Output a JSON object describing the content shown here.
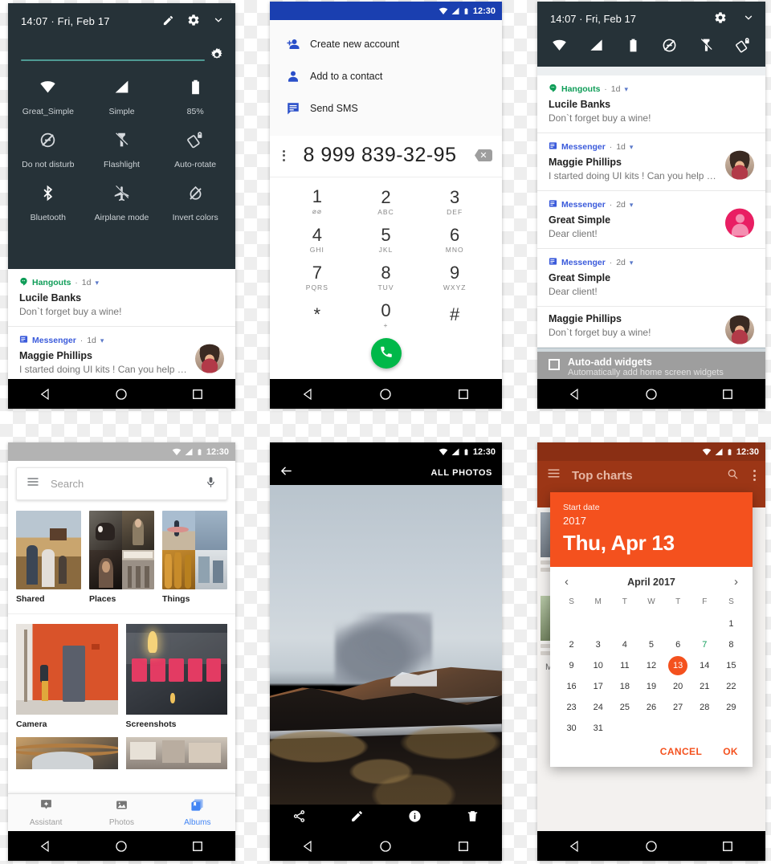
{
  "quick_settings": {
    "time": "14:07  ·  Fri, Feb 17",
    "icons": {
      "edit": "pencil-icon",
      "settings": "gear-icon",
      "collapse": "chevron-down-icon"
    },
    "brightness": {
      "value": 98,
      "knob": "brightness-icon"
    },
    "tiles": [
      {
        "label": "Great_Simple",
        "icon": "wifi-icon"
      },
      {
        "label": "Simple",
        "icon": "signal-icon"
      },
      {
        "label": "85%",
        "icon": "battery-icon"
      },
      {
        "label": "Do not disturb",
        "icon": "do-not-disturb-icon"
      },
      {
        "label": "Flashlight",
        "icon": "flashlight-off-icon"
      },
      {
        "label": "Auto-rotate",
        "icon": "auto-rotate-lock-icon"
      },
      {
        "label": "Bluetooth",
        "icon": "bluetooth-icon"
      },
      {
        "label": "Airplane mode",
        "icon": "airplane-off-icon"
      },
      {
        "label": "Invert colors",
        "icon": "invert-colors-off-icon"
      }
    ],
    "notifications": [
      {
        "app": "Hangouts",
        "app_class": "hangouts",
        "time": "1d",
        "title": "Lucile Banks",
        "body": "Don`t forget buy a wine!",
        "avatar": "none"
      },
      {
        "app": "Messenger",
        "app_class": "messenger",
        "time": "1d",
        "title": "Maggie Phillips",
        "body": "I started doing UI kits ! Can you help …",
        "avatar": "person"
      }
    ]
  },
  "dialer": {
    "status_time": "12:30",
    "menu": [
      {
        "label": "Create new account",
        "icon": "person-add-icon"
      },
      {
        "label": "Add to a contact",
        "icon": "person-icon"
      },
      {
        "label": "Send SMS",
        "icon": "message-icon"
      }
    ],
    "number": "8 999 839-32-95",
    "overflow_icon": "more-vert-icon",
    "backspace_icon": "backspace-icon",
    "call_icon": "phone-icon",
    "keys": [
      {
        "num": "1",
        "sub": "⌀⌀"
      },
      {
        "num": "2",
        "sub": "ABC"
      },
      {
        "num": "3",
        "sub": "DEF"
      },
      {
        "num": "4",
        "sub": "GHI"
      },
      {
        "num": "5",
        "sub": "JKL"
      },
      {
        "num": "6",
        "sub": "MNO"
      },
      {
        "num": "7",
        "sub": "PQRS"
      },
      {
        "num": "8",
        "sub": "TUV"
      },
      {
        "num": "9",
        "sub": "WXYZ"
      },
      {
        "num": "*",
        "sub": ""
      },
      {
        "num": "0",
        "sub": "+"
      },
      {
        "num": "#",
        "sub": ""
      }
    ]
  },
  "notification_shade": {
    "time": "14:07  ·  Fri, Feb 17",
    "settings_icon": "gear-icon",
    "collapse_icon": "chevron-down-icon",
    "quick_icons": [
      "wifi-icon",
      "signal-icon",
      "battery-icon",
      "do-not-disturb-icon",
      "flashlight-off-icon",
      "auto-rotate-lock-icon"
    ],
    "notifications": [
      {
        "app": "Hangouts",
        "app_class": "hangouts",
        "time": "1d",
        "title": "Lucile Banks",
        "body": "Don`t forget buy a wine!",
        "avatar": "none"
      },
      {
        "app": "Messenger",
        "app_class": "messenger",
        "time": "1d",
        "title": "Maggie Phillips",
        "body": "I started doing UI kits ! Can you help …",
        "avatar": "person"
      },
      {
        "app": "Messenger",
        "app_class": "messenger",
        "time": "2d",
        "title": "Great Simple",
        "body": "Dear client!",
        "avatar": "pink"
      },
      {
        "app": "Messenger",
        "app_class": "messenger",
        "time": "2d",
        "title": "Great Simple",
        "body": "Dear client!",
        "avatar": "none"
      },
      {
        "app": "",
        "app_class": "",
        "time": "",
        "title": "Maggie Phillips",
        "body": "Don`t forget buy a wine!",
        "avatar": "person"
      }
    ],
    "peek": {
      "title": "Auto-add widgets",
      "subtitle": "Automatically add home screen widgets"
    }
  },
  "photos_albums": {
    "status_time": "12:30",
    "search": {
      "placeholder": "Search",
      "menu_icon": "hamburger-icon",
      "mic_icon": "microphone-icon"
    },
    "categories": [
      {
        "label": "Shared"
      },
      {
        "label": "Places"
      },
      {
        "label": "Things"
      }
    ],
    "albums": [
      {
        "label": "Camera"
      },
      {
        "label": "Screenshots"
      }
    ],
    "tabs": [
      {
        "label": "Assistant",
        "icon": "assistant-icon",
        "active": false
      },
      {
        "label": "Photos",
        "icon": "photo-icon",
        "active": false
      },
      {
        "label": "Albums",
        "icon": "albums-icon",
        "active": true
      }
    ]
  },
  "photo_viewer": {
    "status_time": "12:30",
    "back_icon": "arrow-back-icon",
    "title": "ALL PHOTOS",
    "actions": [
      {
        "icon": "share-icon"
      },
      {
        "icon": "edit-pencil-icon"
      },
      {
        "icon": "info-icon"
      },
      {
        "icon": "delete-trash-icon"
      }
    ]
  },
  "date_picker": {
    "status_time": "12:30",
    "appbar": {
      "title": "Top charts",
      "menu_icon": "hamburger-icon",
      "search_icon": "search-icon",
      "overflow_icon": "more-vert-icon"
    },
    "background_name": "Mark D. Sikes",
    "dialog": {
      "label": "Start date",
      "year": "2017",
      "date": "Thu, Apr 13",
      "month": "April 2017",
      "prev_icon": "chevron-left-icon",
      "next_icon": "chevron-right-icon",
      "dow": [
        "S",
        "M",
        "T",
        "W",
        "T",
        "F",
        "S"
      ],
      "blanks_before": 6,
      "days": [
        1,
        2,
        3,
        4,
        5,
        6,
        7,
        8,
        9,
        10,
        11,
        12,
        13,
        14,
        15,
        16,
        17,
        18,
        19,
        20,
        21,
        22,
        23,
        24,
        25,
        26,
        27,
        28,
        29,
        30,
        31
      ],
      "selected": 13,
      "today": 7,
      "cancel": "CANCEL",
      "ok": "OK"
    }
  },
  "navbar": {
    "back": "back-triangle-icon",
    "home": "home-circle-icon",
    "recents": "recents-square-icon"
  },
  "colors": {
    "dark_panel": "#263238",
    "dialer_blue": "#1a3fb0",
    "accent_orange": "#f4511e",
    "appbar_orange": "#9c3616",
    "green_call": "#00b849",
    "teal_slider": "#4f9a94",
    "blue_tab": "#4285f4"
  }
}
